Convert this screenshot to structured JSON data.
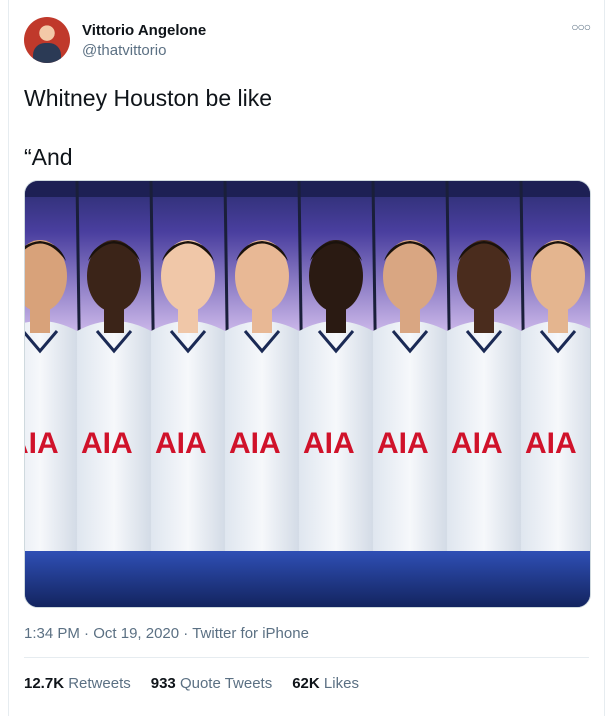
{
  "user": {
    "name": "Vittorio Angelone",
    "handle": "@thatvittorio"
  },
  "tweet": {
    "line1": "Whitney Houston be like",
    "line2": "“And"
  },
  "media": {
    "sponsor_text": "AIA"
  },
  "meta": {
    "time": "1:34 PM",
    "sep1": " · ",
    "date": "Oct 19, 2020",
    "sep2": " · ",
    "source": "Twitter for iPhone"
  },
  "stats": {
    "retweets_count": "12.7K",
    "retweets_label": "Retweets",
    "quotes_count": "933",
    "quotes_label": "Quote Tweets",
    "likes_count": "62K",
    "likes_label": "Likes"
  },
  "icons": {
    "more": "more-options-icon"
  }
}
